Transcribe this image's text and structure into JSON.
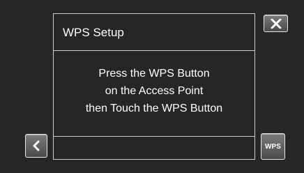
{
  "dialog": {
    "title": "WPS Setup",
    "message_lines": [
      "Press the WPS Button",
      "on the Access Point",
      "then Touch the WPS Button"
    ]
  },
  "buttons": {
    "close_icon": "close-icon",
    "back_icon": "chevron-left-icon",
    "wps_label": "WPS"
  },
  "colors": {
    "background": "#262626",
    "border": "#cfcfcf",
    "text": "#ffffff"
  }
}
